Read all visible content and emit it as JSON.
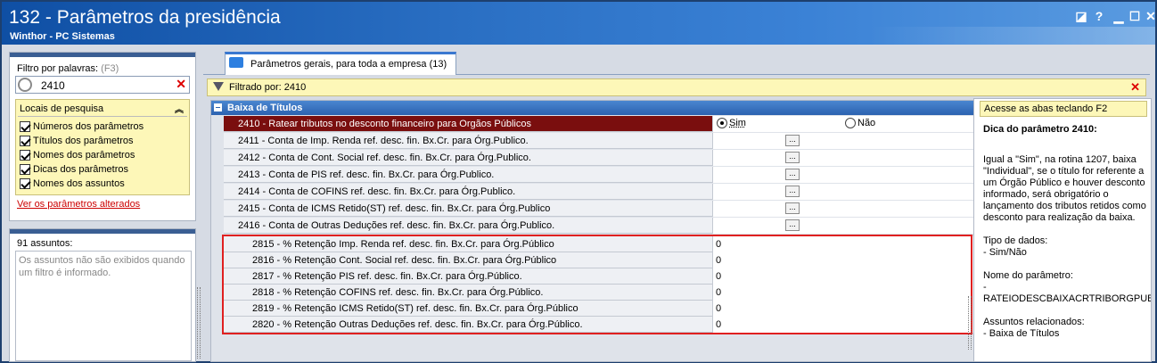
{
  "window": {
    "title": "132 - Parâmetros da presidência",
    "subtitle": "Winthor - PC Sistemas",
    "controls": [
      "restore-icon",
      "help-icon",
      "minimize-icon",
      "maximize-icon",
      "close-icon"
    ]
  },
  "left": {
    "filter_label": "Filtro por palavras:",
    "filter_shortcut": "(F3)",
    "search_value": "2410",
    "locais_title": "Locais de pesquisa",
    "locais": [
      {
        "label": "Números dos parâmetros",
        "checked": true
      },
      {
        "label": "Títulos dos parâmetros",
        "checked": true
      },
      {
        "label": "Nomes dos parâmetros",
        "checked": true
      },
      {
        "label": "Dicas dos parâmetros",
        "checked": true
      },
      {
        "label": "Nomes dos assuntos",
        "checked": true
      }
    ],
    "link": "Ver os parâmetros alterados",
    "assuntos_count": "91 assuntos:",
    "assuntos_note": "Os assuntos não são exibidos quando um filtro é informado."
  },
  "tab": {
    "label": "Parâmetros gerais, para toda a empresa",
    "count": "(13)"
  },
  "filterbar": {
    "text": "Filtrado por: 2410"
  },
  "grid": {
    "group": "Baixa de Títulos",
    "rows": [
      {
        "name": "2410 - Ratear tributos no desconto financeiro para Orgãos Públicos",
        "type": "radio",
        "opt1": "Sim",
        "opt2": "Não",
        "selected": "Sim"
      },
      {
        "name": "2411 - Conta de Imp. Renda ref. desc. fin. Bx.Cr. para Órg.Publico.",
        "type": "dots"
      },
      {
        "name": "2412 - Conta de Cont. Social ref. desc. fin. Bx.Cr. para Órg.Publico.",
        "type": "dots"
      },
      {
        "name": "2413 - Conta de PIS ref. desc. fin. Bx.Cr. para Órg.Publico.",
        "type": "dots"
      },
      {
        "name": "2414 - Conta de COFINS ref. desc. fin. Bx.Cr. para Órg.Publico.",
        "type": "dots"
      },
      {
        "name": "2415 - Conta de ICMS Retido(ST) ref. desc. fin. Bx.Cr. para Órg.Publico",
        "type": "dots"
      },
      {
        "name": "2416 - Conta de Outras Deduções ref. desc. fin. Bx.Cr. para Órg.Publico.",
        "type": "dots"
      },
      {
        "name": "2815 - % Retenção Imp. Renda ref. desc. fin. Bx.Cr. para Órg.Público",
        "type": "num",
        "value": "0"
      },
      {
        "name": "2816 - % Retenção Cont. Social ref. desc. fin. Bx.Cr. para Órg.Público",
        "type": "num",
        "value": "0"
      },
      {
        "name": "2817 - % Retenção PIS ref. desc. fin. Bx.Cr. para Órg.Público.",
        "type": "num",
        "value": "0"
      },
      {
        "name": "2818 - % Retenção COFINS ref. desc. fin. Bx.Cr. para Órg.Público.",
        "type": "num",
        "value": "0"
      },
      {
        "name": "2819 - % Retenção ICMS Retido(ST) ref. desc. fin. Bx.Cr. para Órg.Público",
        "type": "num",
        "value": "0"
      },
      {
        "name": "2820 - % Retenção Outras Deduções ref. desc. fin. Bx.Cr. para Órg.Público.",
        "type": "num",
        "value": "0"
      }
    ],
    "dots_label": "..."
  },
  "right": {
    "hint": "Acesse as abas teclando F2",
    "title": "Dica do parâmetro 2410:",
    "paragraphs": [
      "Igual a \"Sim\", na rotina 1207, baixa \"Individual\", se o título for referente a um Órgão Público e houver desconto informado, será obrigatório o lançamento dos tributos retidos como desconto para realização da baixa.",
      "Tipo de dados:\n  - Sim/Não",
      "Nome do parâmetro:\n  -\nRATEIODESCBAIXACRTRIBORGPUB",
      "Assuntos relacionados:\n  - Baixa de Títulos"
    ]
  },
  "colors": {
    "title_bar": "#1f5fb5",
    "selected_row": "#7a0e0e",
    "highlight_border": "#e02020",
    "filter_bg": "#fdf7b8"
  }
}
